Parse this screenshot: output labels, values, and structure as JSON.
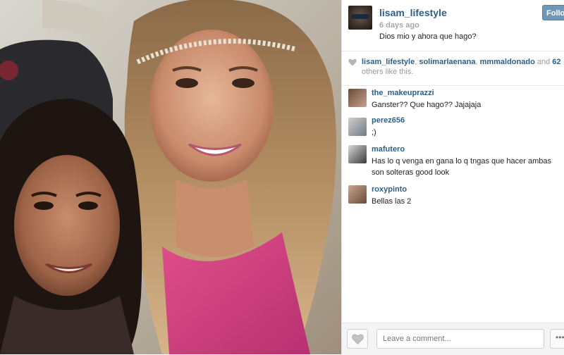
{
  "post": {
    "author": "lisam_lifestyle",
    "time_ago": "6 days ago",
    "caption": "Dios mio y ahora que hago?",
    "follow_label": "Follo"
  },
  "likes": {
    "users": [
      "lisam_lifestyle",
      "solimarlaenana",
      "mmmaldonado"
    ],
    "separator": ", ",
    "and_text": " and ",
    "count": "62",
    "suffix": " others like this."
  },
  "comments": [
    {
      "user": "the_makeuprazzi",
      "text": "Ganster?? Que hago?? Jajajaja"
    },
    {
      "user": "perez656",
      "text": ";)"
    },
    {
      "user": "mafutero",
      "text": "Has lo q venga en gana lo q tngas que hacer ambas son solteras good look"
    },
    {
      "user": "roxypinto",
      "text": "Bellas las 2"
    }
  ],
  "composer": {
    "placeholder": "Leave a comment...",
    "more_label": "•••"
  },
  "colors": {
    "link": "#2d5f87",
    "follow_button": "#6f97b6",
    "muted": "#9a9a9a"
  },
  "icons": [
    "heart-icon",
    "heart-outline-icon",
    "more-icon"
  ]
}
